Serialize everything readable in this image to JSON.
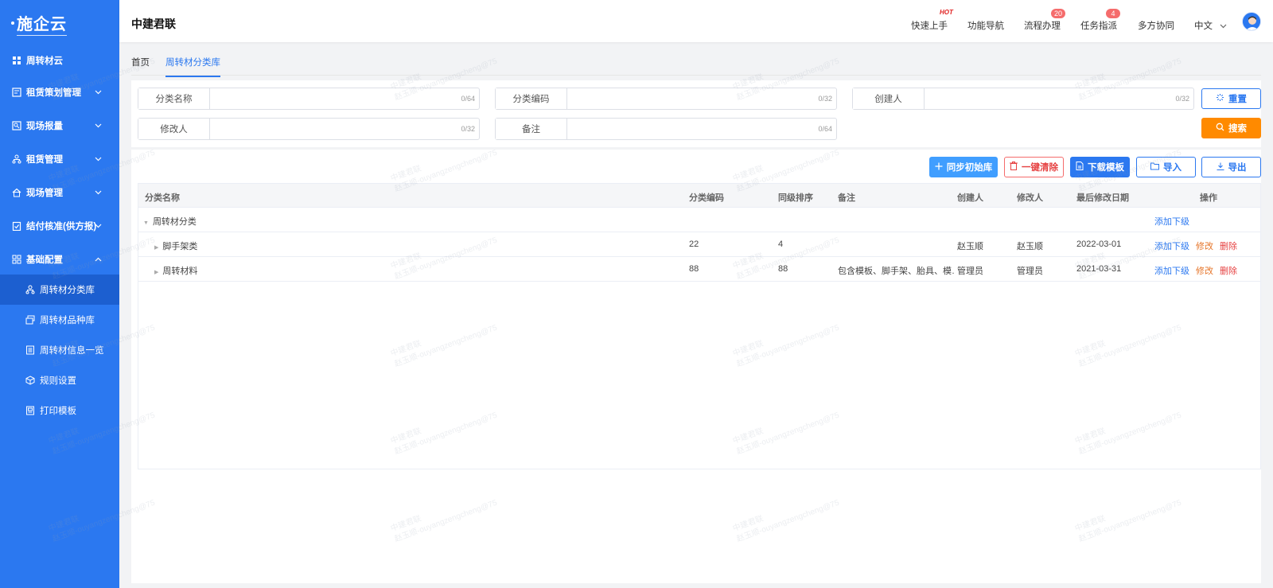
{
  "sidebar": {
    "logo": "施企云",
    "items": [
      {
        "label": "周转材云",
        "icon": "grid-icon"
      },
      {
        "label": "租赁策划管理",
        "icon": "plan-icon"
      },
      {
        "label": "现场报量",
        "icon": "report-icon"
      },
      {
        "label": "租赁管理",
        "icon": "org-icon"
      },
      {
        "label": "现场管理",
        "icon": "home-icon"
      },
      {
        "label": "结付核准(供方报)",
        "icon": "clipboard-check-icon"
      },
      {
        "label": "基础配置",
        "icon": "apps-icon"
      }
    ],
    "subitems": [
      {
        "label": "周转材分类库",
        "icon": "org-icon"
      },
      {
        "label": "周转材品种库",
        "icon": "stack-icon"
      },
      {
        "label": "周转材信息一览",
        "icon": "list-icon"
      },
      {
        "label": "规则设置",
        "icon": "cube-icon"
      },
      {
        "label": "打印模板",
        "icon": "print-icon"
      }
    ]
  },
  "header": {
    "brand": "中建君联",
    "nav": [
      {
        "label": "快速上手",
        "hot": "HOT"
      },
      {
        "label": "功能导航"
      },
      {
        "label": "流程办理",
        "badge": "20"
      },
      {
        "label": "任务指派",
        "badge": "4"
      },
      {
        "label": "多方协同"
      },
      {
        "label": "中文"
      }
    ]
  },
  "tabs": [
    "首页",
    "周转材分类库"
  ],
  "filters": {
    "name": {
      "label": "分类名称",
      "count": "0/64"
    },
    "code": {
      "label": "分类编码",
      "count": "0/32"
    },
    "creator": {
      "label": "创建人",
      "count": "0/32"
    },
    "modifier": {
      "label": "修改人",
      "count": "0/32"
    },
    "remark": {
      "label": "备注",
      "count": "0/64"
    },
    "reset": "重置",
    "search": "搜索"
  },
  "toolbar": {
    "sync": "同步初始库",
    "clear": "一键清除",
    "download": "下载模板",
    "import": "导入",
    "export": "导出"
  },
  "table": {
    "headers": [
      "分类名称",
      "分类编码",
      "同级排序",
      "备注",
      "创建人",
      "修改人",
      "最后修改日期",
      "操作"
    ],
    "root": {
      "name": "周转材分类",
      "action_add": "添加下级"
    },
    "rows": [
      {
        "name": "脚手架类",
        "code": "22",
        "order": "4",
        "remark": "",
        "creator": "赵玉顺",
        "modifier": "赵玉顺",
        "date": "2022-03-01",
        "add": "添加下级",
        "edit": "修改",
        "del": "删除"
      },
      {
        "name": "周转材料",
        "code": "88",
        "order": "88",
        "remark": "包含模板、脚手架、胎具、模…",
        "creator": "管理员",
        "modifier": "管理员",
        "date": "2021-03-31",
        "add": "添加下级",
        "edit": "修改",
        "del": "删除"
      }
    ]
  },
  "watermark": {
    "line1": "中建君联",
    "line2": "赵玉顺-ouyangzengcheng@75"
  },
  "colors": {
    "primary": "#2b78f0",
    "orange": "#ff8a00",
    "danger": "#e64242"
  }
}
